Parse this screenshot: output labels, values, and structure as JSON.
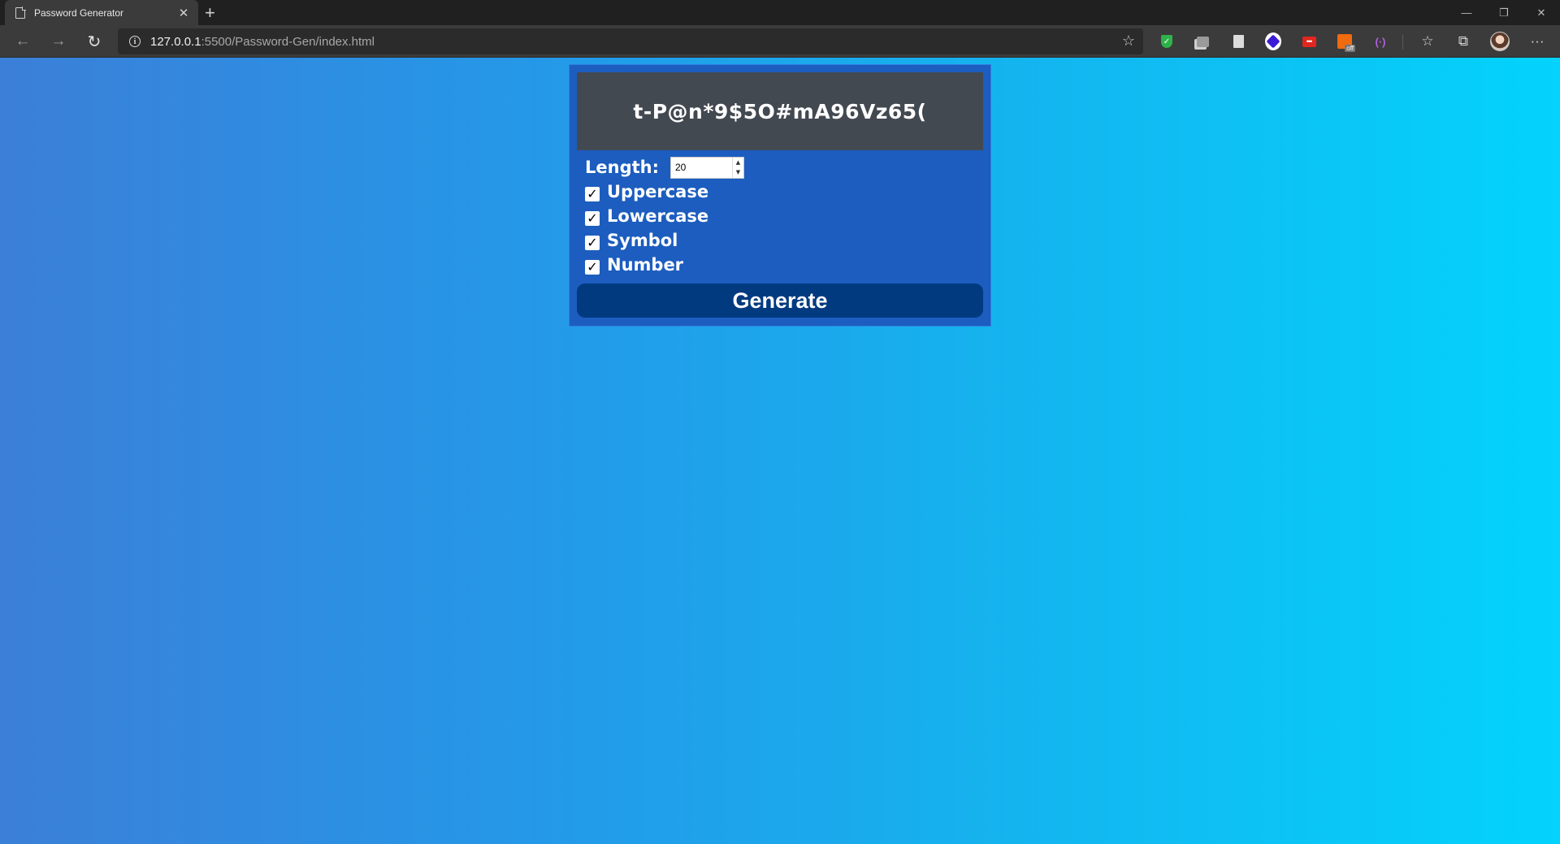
{
  "browser": {
    "tab_title": "Password Generator",
    "tab_close": "✕",
    "new_tab": "+",
    "url_host": "127.0.0.1",
    "url_rest": ":5500/Password-Gen/index.html",
    "window": {
      "minimize": "—",
      "restore": "❐",
      "close": "✕"
    },
    "icons": [
      "back-icon",
      "forward-icon",
      "refresh-icon",
      "info-icon",
      "favorite-star-icon",
      "shield-extension-icon",
      "copy-extension-icon",
      "document-extension-icon",
      "circle-extension-icon",
      "red-extension-icon",
      "orange-extension-icon",
      "purple-extension-icon",
      "favorites-icon",
      "collections-icon",
      "profile-avatar",
      "more-menu-icon"
    ]
  },
  "app": {
    "password": "t-P@n*9$5O#mA96Vz65(",
    "length_label": "Length:",
    "length_value": "20",
    "options": [
      {
        "label": "Uppercase",
        "checked": true
      },
      {
        "label": "Lowercase",
        "checked": true
      },
      {
        "label": "Symbol",
        "checked": true
      },
      {
        "label": "Number",
        "checked": true
      }
    ],
    "generate_label": "Generate"
  },
  "colors": {
    "gradient_start": "#3b7fd8",
    "gradient_end": "#03d3fd",
    "card": "#1c5dbf",
    "display": "#434951",
    "button": "#023a80"
  }
}
